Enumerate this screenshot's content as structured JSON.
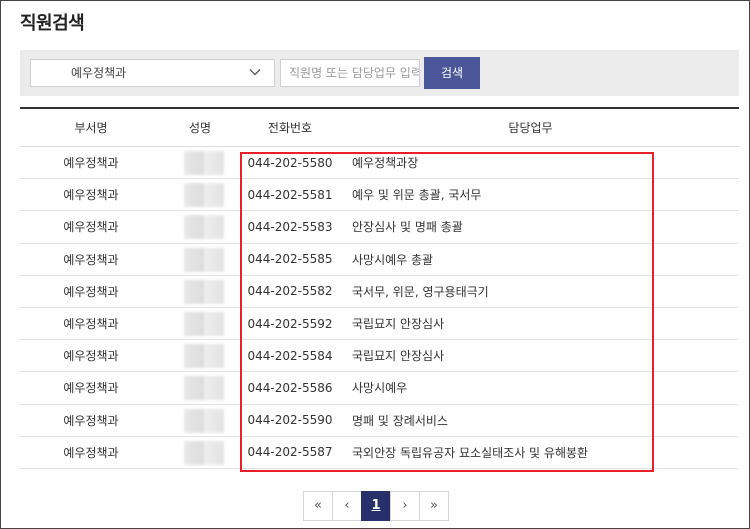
{
  "page": {
    "title": "직원검색"
  },
  "search": {
    "department_selected": "예우정책과",
    "placeholder": "직원명 또는 담당업무 입력",
    "button_label": "검색"
  },
  "table": {
    "headers": [
      "부서명",
      "성명",
      "전화번호",
      "담당업무"
    ],
    "rows": [
      {
        "dept": "예우정책과",
        "phone": "044-202-5580",
        "duty": "예우정책과장"
      },
      {
        "dept": "예우정책과",
        "phone": "044-202-5581",
        "duty": "예우 및 위문 총괄, 국서무"
      },
      {
        "dept": "예우정책과",
        "phone": "044-202-5583",
        "duty": "안장심사 및 명패 총괄"
      },
      {
        "dept": "예우정책과",
        "phone": "044-202-5585",
        "duty": "사망시예우 총괄"
      },
      {
        "dept": "예우정책과",
        "phone": "044-202-5582",
        "duty": "국서무, 위문, 영구용태극기"
      },
      {
        "dept": "예우정책과",
        "phone": "044-202-5592",
        "duty": "국립묘지 안장심사"
      },
      {
        "dept": "예우정책과",
        "phone": "044-202-5584",
        "duty": "국립묘지 안장심사"
      },
      {
        "dept": "예우정책과",
        "phone": "044-202-5586",
        "duty": "사망시예우"
      },
      {
        "dept": "예우정책과",
        "phone": "044-202-5590",
        "duty": "명패 및 장례서비스"
      },
      {
        "dept": "예우정책과",
        "phone": "044-202-5587",
        "duty": "국외안장 독립유공자 묘소실태조사 및 유해봉환"
      }
    ]
  },
  "pagination": {
    "first": "«",
    "prev": "‹",
    "current": "1",
    "next": "›",
    "last": "»"
  },
  "colors": {
    "accent": "#4a5698",
    "highlight": "#e8202a",
    "active_page": "#27306b"
  }
}
